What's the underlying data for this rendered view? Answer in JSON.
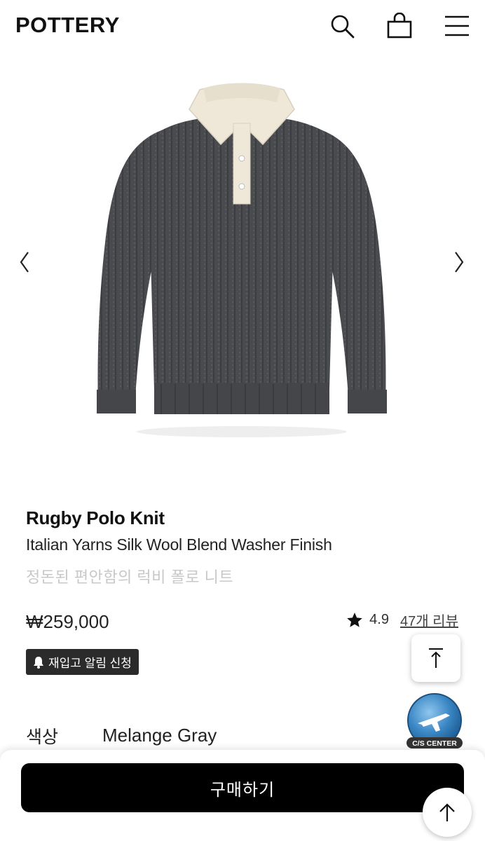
{
  "header": {
    "logo": "POTTERY",
    "icons": [
      "search-icon",
      "shopping-bag-icon",
      "menu-icon"
    ]
  },
  "gallery": {
    "prev_icon": "chevron-left-icon",
    "next_icon": "chevron-right-icon",
    "colors": {
      "knit": "#4a4b4e",
      "collar": "#efe8d8"
    }
  },
  "product": {
    "name": "Rugby Polo Knit",
    "subtitle": "Italian Yarns Silk Wool Blend Washer Finish",
    "description_ko": "정돈된 편안함의 럭비 폴로 니트",
    "price": "₩259,000",
    "rating": "4.9",
    "reviews": "47개 리뷰",
    "restock_label": "재입고 알림 신청",
    "color_label": "색상",
    "color_value": "Melange Gray"
  },
  "floating": {
    "cs_center": "C/S CENTER"
  },
  "bottom_bar": {
    "buy_label": "구매하기"
  },
  "colors": {
    "buy_button": "#000000",
    "description_gray": "#c8c8c8",
    "cs_badge": "#3a86c4"
  }
}
